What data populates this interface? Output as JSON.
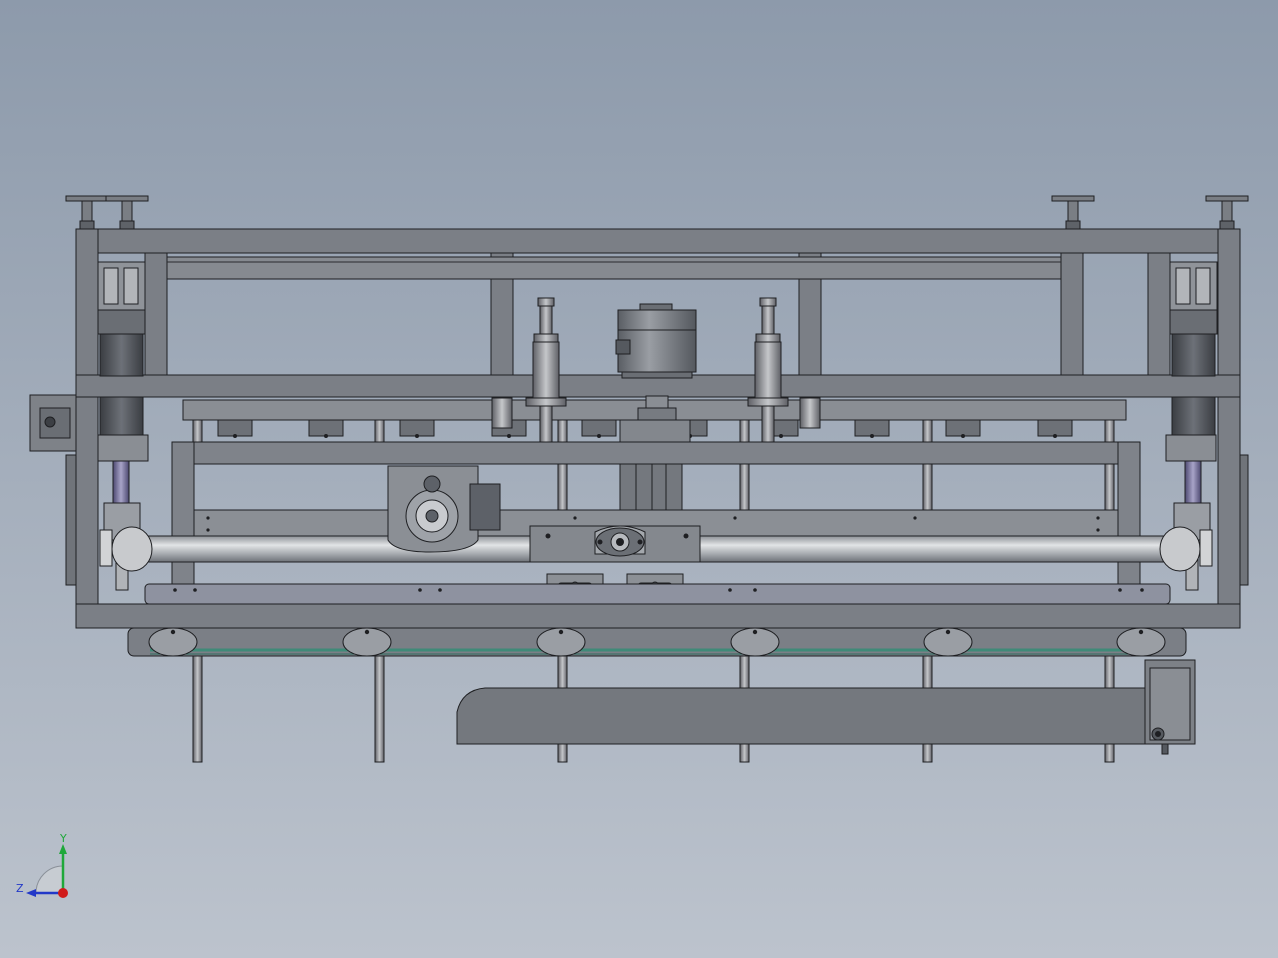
{
  "view": {
    "background_top": "#8d9aab",
    "background_bottom": "#bcc3cd"
  },
  "colors": {
    "steel": "#7b7f86",
    "steel_dark": "#5d6168",
    "steel_light": "#a3a7ad",
    "outline": "#1e1f22",
    "shaft": "#b9bcc0",
    "belt": "#3f8a78",
    "strut": "#3e4046",
    "accent_purple": "#6c6790"
  },
  "triad": {
    "y_label": "Y",
    "z_label": "Z",
    "y_color": "#1fa83a",
    "z_color": "#2238c8",
    "origin_color": "#d01a1a",
    "icon": "axis-triad-icon"
  }
}
